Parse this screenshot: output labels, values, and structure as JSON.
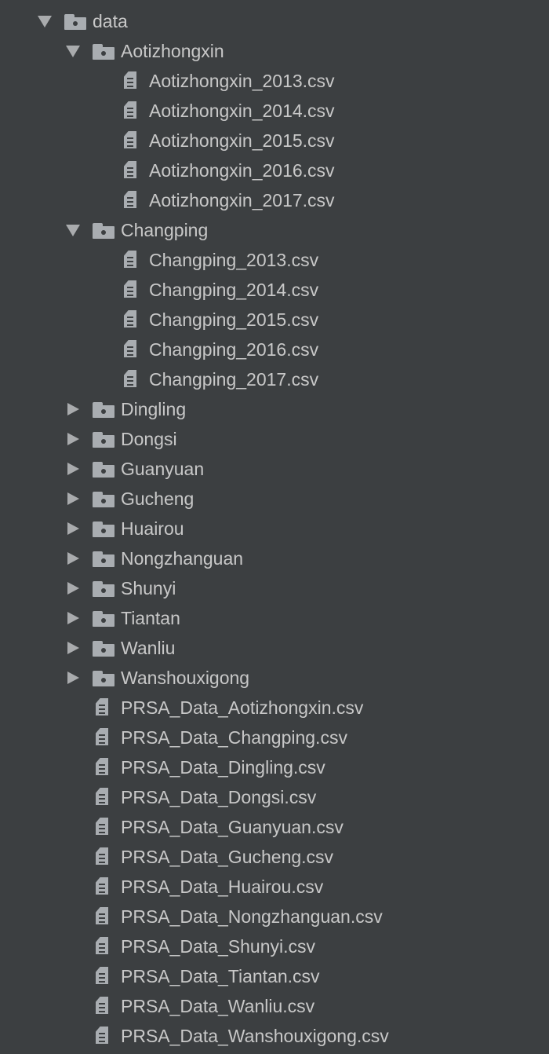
{
  "tree": {
    "root": {
      "label": "data",
      "expanded": true
    },
    "folders": [
      {
        "label": "Aotizhongxin",
        "expanded": true,
        "files": [
          "Aotizhongxin_2013.csv",
          "Aotizhongxin_2014.csv",
          "Aotizhongxin_2015.csv",
          "Aotizhongxin_2016.csv",
          "Aotizhongxin_2017.csv"
        ]
      },
      {
        "label": "Changping",
        "expanded": true,
        "files": [
          "Changping_2013.csv",
          "Changping_2014.csv",
          "Changping_2015.csv",
          "Changping_2016.csv",
          "Changping_2017.csv"
        ]
      },
      {
        "label": "Dingling",
        "expanded": false
      },
      {
        "label": "Dongsi",
        "expanded": false
      },
      {
        "label": "Guanyuan",
        "expanded": false
      },
      {
        "label": "Gucheng",
        "expanded": false
      },
      {
        "label": "Huairou",
        "expanded": false
      },
      {
        "label": "Nongzhanguan",
        "expanded": false
      },
      {
        "label": "Shunyi",
        "expanded": false
      },
      {
        "label": "Tiantan",
        "expanded": false
      },
      {
        "label": "Wanliu",
        "expanded": false
      },
      {
        "label": "Wanshouxigong",
        "expanded": false
      }
    ],
    "files": [
      "PRSA_Data_Aotizhongxin.csv",
      "PRSA_Data_Changping.csv",
      "PRSA_Data_Dingling.csv",
      "PRSA_Data_Dongsi.csv",
      "PRSA_Data_Guanyuan.csv",
      "PRSA_Data_Gucheng.csv",
      "PRSA_Data_Huairou.csv",
      "PRSA_Data_Nongzhanguan.csv",
      "PRSA_Data_Shunyi.csv",
      "PRSA_Data_Tiantan.csv",
      "PRSA_Data_Wanliu.csv",
      "PRSA_Data_Wanshouxigong.csv"
    ]
  },
  "icons": {
    "folder": "folder-icon",
    "file": "file-icon",
    "expanded": "chevron-down-icon",
    "collapsed": "chevron-right-icon"
  },
  "colors": {
    "background": "#3c3f41",
    "text": "#c8c8c8",
    "icon": "#a9adb1"
  }
}
